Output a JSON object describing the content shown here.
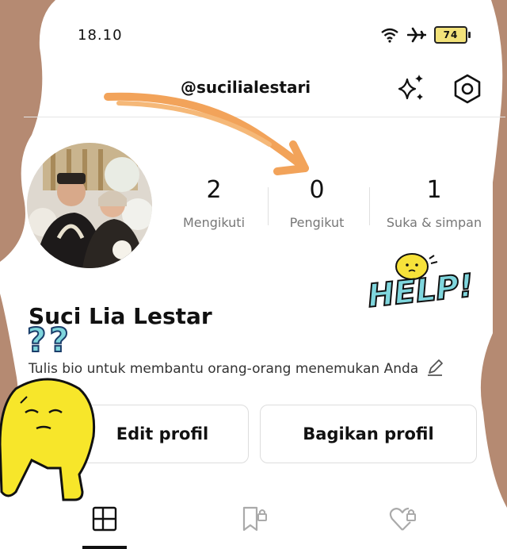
{
  "status_bar": {
    "time": "18.10",
    "battery": "74"
  },
  "header": {
    "username": "@sucilialestari"
  },
  "profile": {
    "stats": [
      {
        "value": "2",
        "label": "Mengikuti"
      },
      {
        "value": "0",
        "label": "Pengikut"
      },
      {
        "value": "1",
        "label": "Suka & simpan"
      }
    ],
    "name": "Suci Lia Lestar",
    "bio": "Tulis bio untuk membantu orang-orang menemukan Anda"
  },
  "buttons": {
    "edit": "Edit profil",
    "share": "Bagikan profil"
  },
  "stickers": {
    "help": "HELP!",
    "question": "??"
  },
  "icons": {
    "wifi": "wifi-icon",
    "airplane": "airplane-icon",
    "sparkle": "sparkle-icon",
    "settings": "hexagon-gear-icon",
    "grid": "grid-tab-icon",
    "bookmark_lock": "bookmark-lock-icon",
    "heart_lock": "heart-lock-icon",
    "edit": "pencil-icon"
  }
}
